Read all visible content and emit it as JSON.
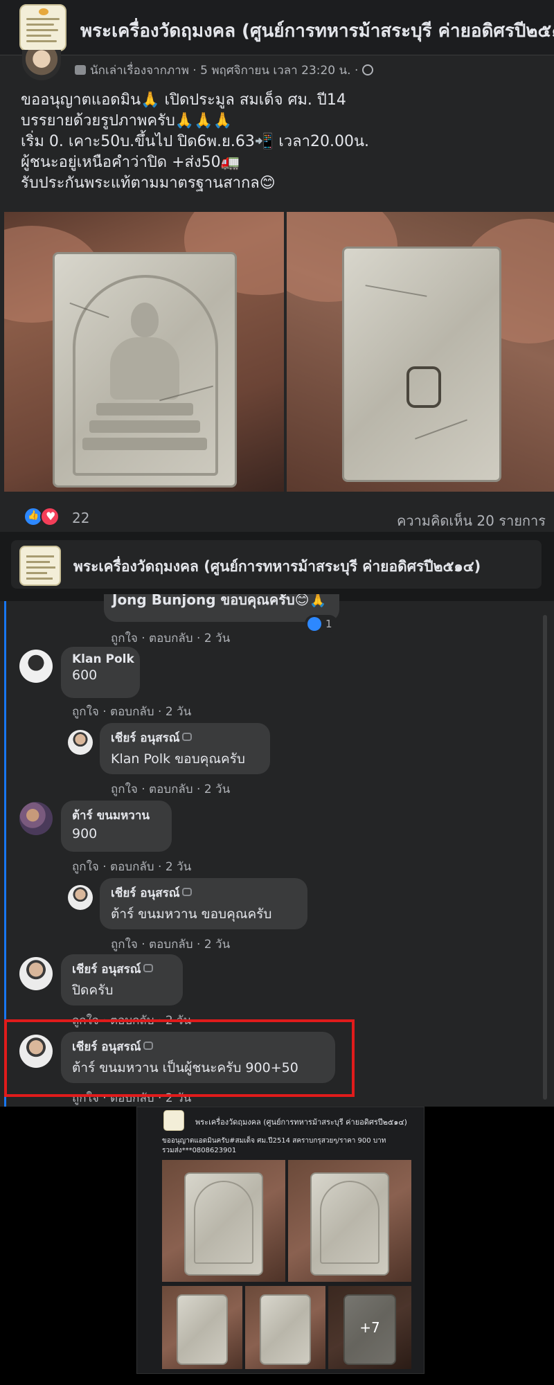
{
  "post": {
    "group_name": "พระเครื่องวัดฤมงคล (ศูนย์การทหารม้าสระบุรี ค่ายอดิศรปี๒๕๑",
    "author_line": "นักเล่าเรื่องจากภาพ · 5 พฤศจิกายน เวลา 23:20 น. ·",
    "text_lines": [
      "ขออนุญาตแอดมิน🙏 เปิดประมูล สมเด็จ ศม. ปี14",
      "บรรยายด้วยรูปภาพครับ🙏🙏🙏",
      "เริ่ม 0. เคาะ50บ.ขึ้นไป ปิด6พ.ย.63📲 เวลา20.00น.",
      "ผู้ชนะอยู่เหนือคำว่าปิด +ส่ง50🚛",
      "รับประกันพระแท้ตามมาตรฐานสากล😊"
    ],
    "reaction_count": "22",
    "comment_count": "ความคิดเห็น 20 รายการ",
    "icons": [
      "chat-icon",
      "globe-icon",
      "like-icon",
      "love-icon"
    ]
  },
  "comments": {
    "group_name": "พระเครื่องวัดฤมงคล (ศูนย์การทหารม้าสระบุรี ค่ายอดิศรปี๒๕๑๔)",
    "partial_comment": {
      "name_fragment": "Jong Bunjong ขอบคุณครับ😊🙏",
      "reaction_count": "1",
      "actions": "ถูกใจ · ตอบกลับ · 2 วัน"
    },
    "items": [
      {
        "name": "Klan Polk",
        "text": "600",
        "actions": "ถูกใจ · ตอบกลับ · 2 วัน"
      },
      {
        "name": "เชียร์ อนุสรณ์",
        "text": "Klan Polk ขอบคุณครับ",
        "actions": "ถูกใจ · ตอบกลับ · 2 วัน"
      },
      {
        "name": "ต้าร์ ขนมหวาน",
        "text": "900",
        "actions": "ถูกใจ · ตอบกลับ · 2 วัน"
      },
      {
        "name": "เชียร์ อนุสรณ์",
        "text": "ต้าร์ ขนมหวาน ขอบคุณครับ",
        "actions": "ถูกใจ · ตอบกลับ · 2 วัน"
      },
      {
        "name": "เชียร์ อนุสรณ์",
        "text": "ปิดครับ",
        "actions": "ถูกใจ · ตอบกลับ · 2 วัน"
      },
      {
        "name": "เชียร์ อนุสรณ์",
        "text": "ต้าร์ ขนมหวาน เป็นผู้ชนะครับ 900+50",
        "actions": "ถูกใจ · ตอบกลับ · 2 วัน"
      }
    ],
    "highlight_color": "#e01b1b"
  },
  "shared": {
    "group_name": "พระเครื่องวัดฤมงคล (ศูนย์การทหารม้าสระบุรี ค่ายอดิศรปี๒๕๑๔)",
    "text_line1": "ขออนุญาตแอดมินครับ#สมเด็จ ศม.ปี2514 สคราบกรุสวยๆ/ราคา 900 บาท",
    "text_line2": "รวมส่ง***0808623901",
    "more_count": "+7"
  },
  "colors": {
    "background": "#18191a",
    "card": "#242526",
    "bubble": "#3a3b3c",
    "accent": "#1877f2",
    "like": "#2d88ff",
    "love": "#f33e58"
  }
}
